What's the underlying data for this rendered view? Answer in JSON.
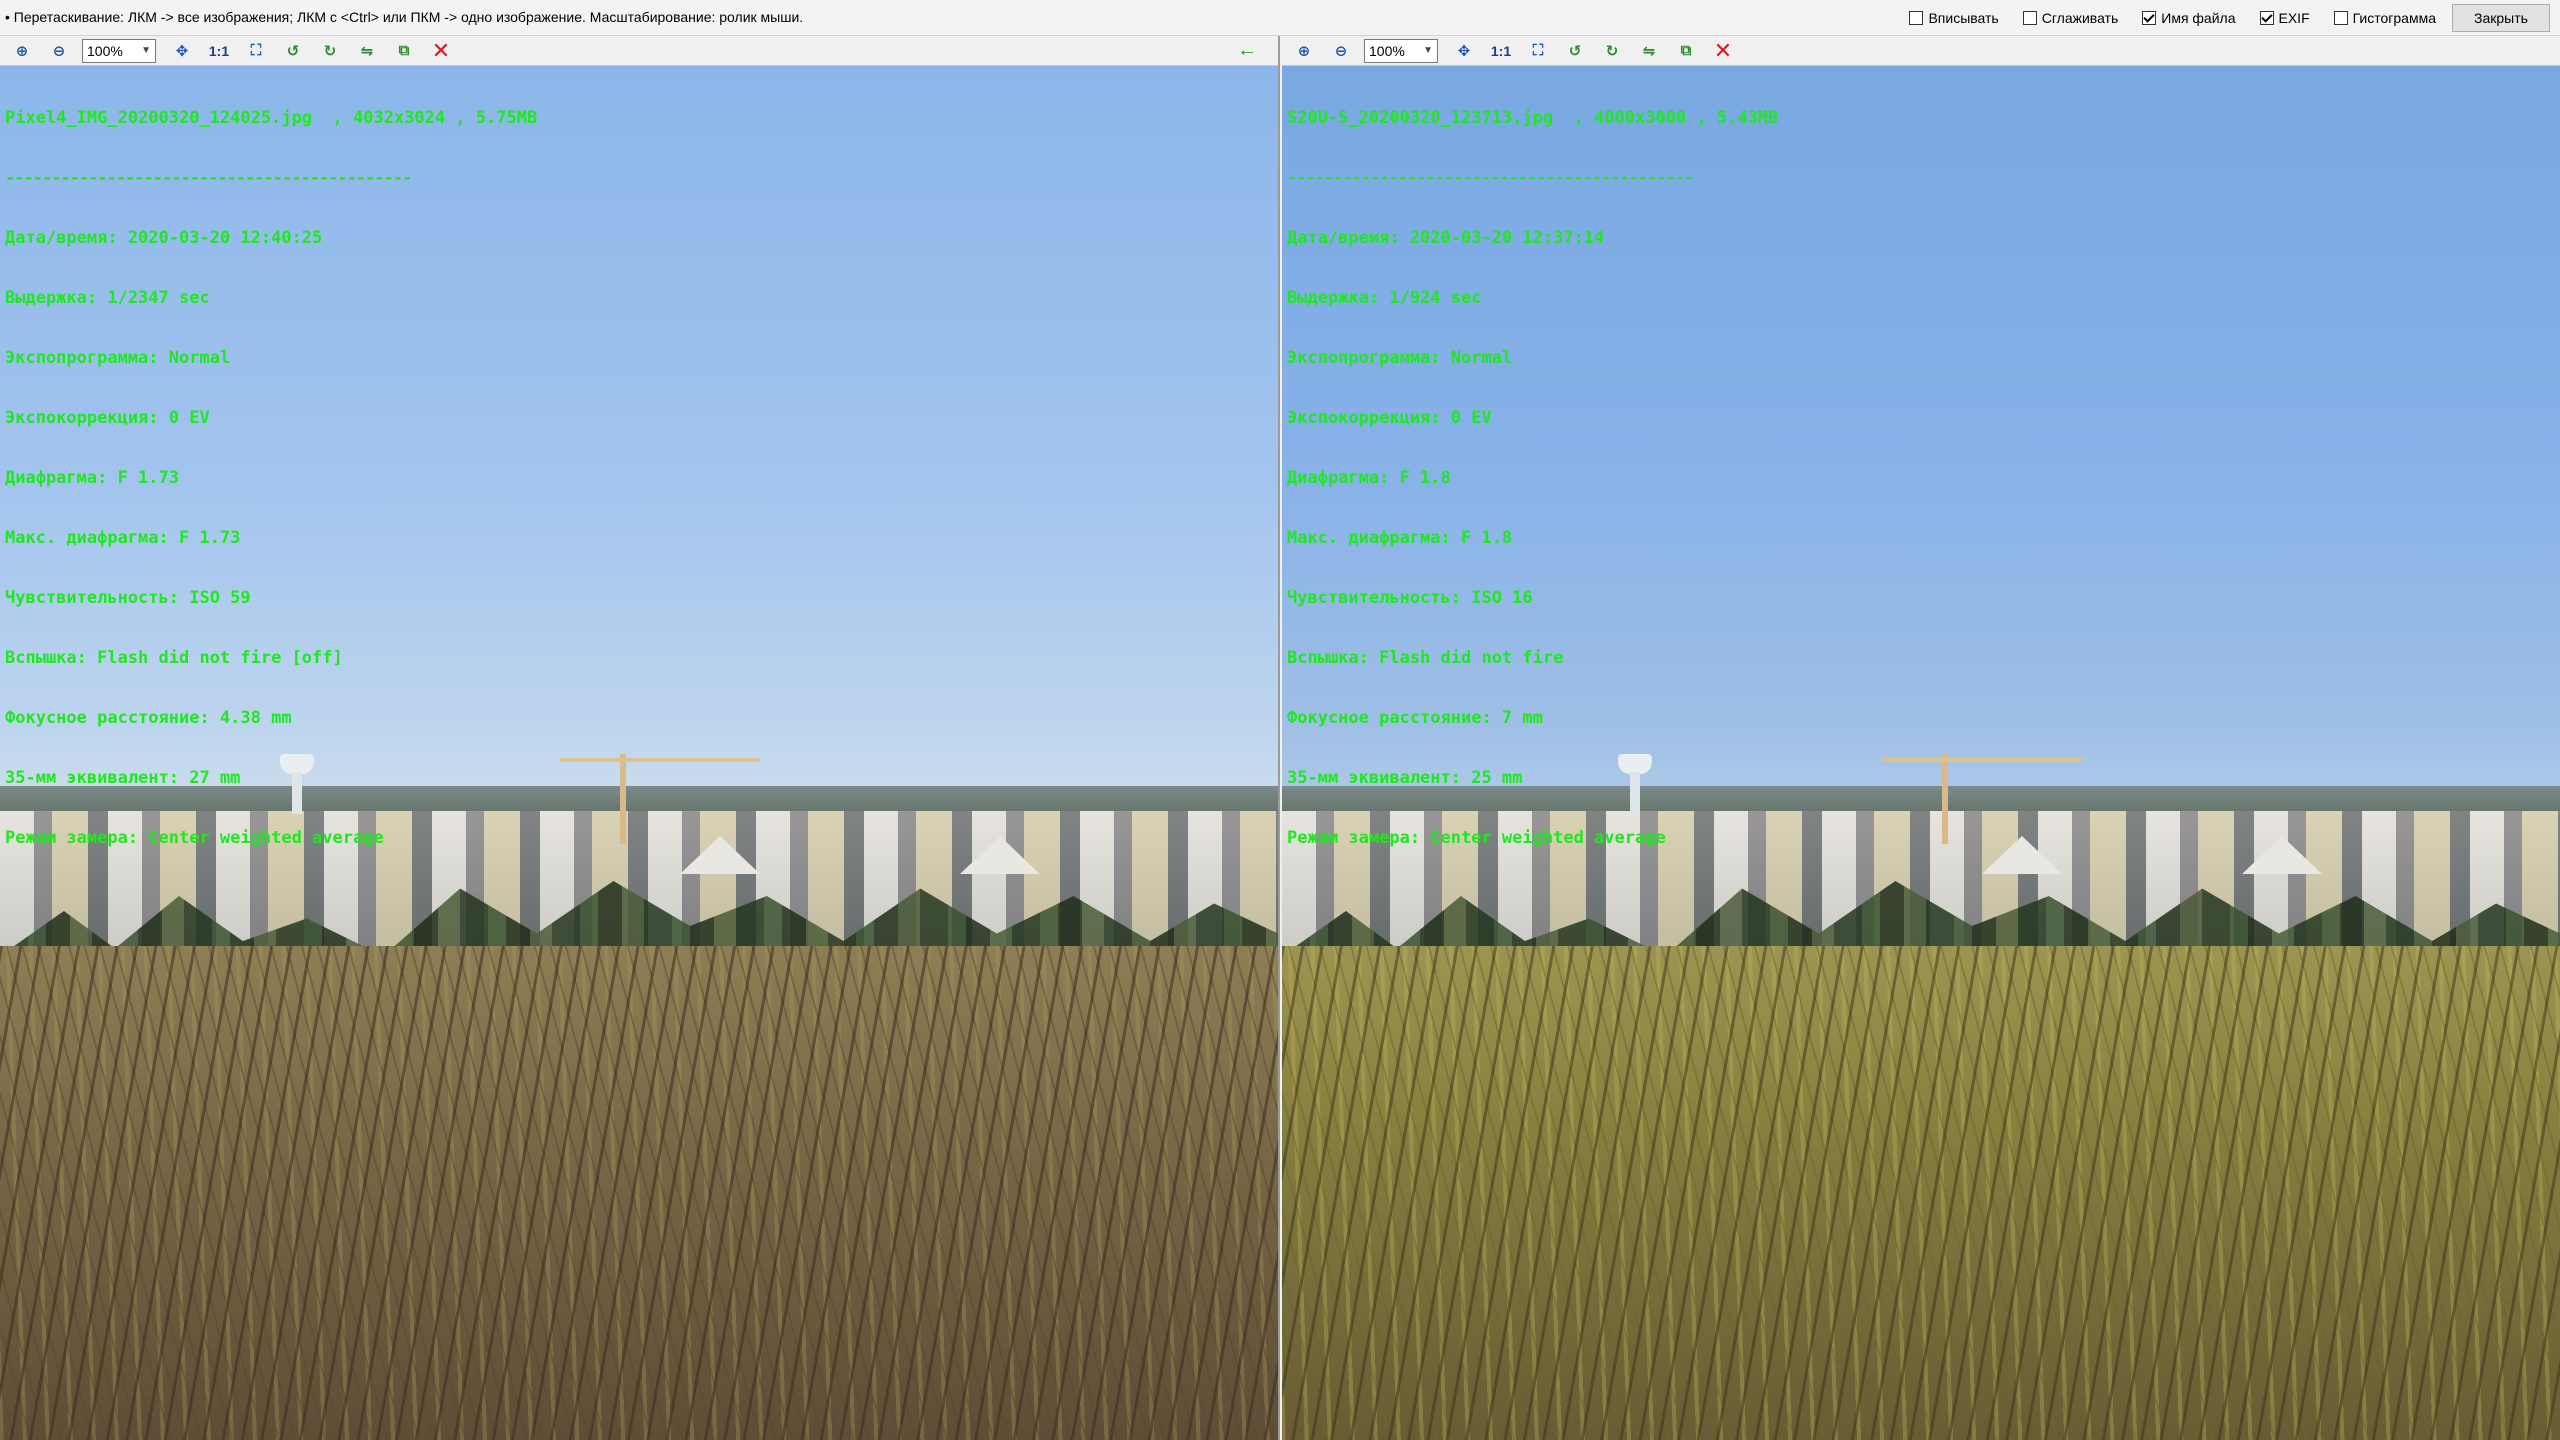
{
  "hint": "• Перетаскивание: ЛКМ -> все изображения; ЛКМ с <Ctrl> или ПКМ -> одно изображение. Масштабирование: ролик мыши.",
  "options": [
    {
      "label": "Вписывать",
      "checked": false
    },
    {
      "label": "Сглаживать",
      "checked": false
    },
    {
      "label": "Имя файла",
      "checked": true
    },
    {
      "label": "EXIF",
      "checked": true
    },
    {
      "label": "Гистограмма",
      "checked": false
    }
  ],
  "close_label": "Закрыть",
  "icons": {
    "zoom_in": "zoom-in-icon",
    "zoom_out": "zoom-out-icon",
    "one_to_one": "1:1",
    "fit": "fit-icon",
    "close": "close-icon",
    "sync": "arrow-left-icon"
  },
  "colors": {
    "exif_text": "#1ee81e",
    "close_icon": "#d81b1b"
  },
  "left": {
    "zoom": "100%",
    "header": "Pixel4_IMG_20200320_124025.jpg  , 4032x3024 , 5.75MB",
    "separator": "--------------------------------------------",
    "exif": [
      "Дата/время: 2020-03-20 12:40:25",
      "Выдержка: 1/2347 sec",
      "Экспопрограмма: Normal",
      "Экспокоррекция: 0 EV",
      "Диафрагма: F 1.73",
      "Макс. диафрагма: F 1.73",
      "Чувствительность: ISO 59",
      "Вспышка: Flash did not fire [off]",
      "Фокусное расстояние: 4.38 mm",
      "35-мм эквивалент: 27 mm",
      "Режим замера: Center weighted average"
    ]
  },
  "right": {
    "zoom": "100%",
    "header": "S20U-S_20200320_123713.jpg  , 4000x3000 , 5.43MB",
    "separator": "--------------------------------------------",
    "exif": [
      "Дата/время: 2020-03-20 12:37:14",
      "Выдержка: 1/924 sec",
      "Экспопрограмма: Normal",
      "Экспокоррекция: 0 EV",
      "Диафрагма: F 1.8",
      "Макс. диафрагма: F 1.8",
      "Чувствительность: ISO 16",
      "Вспышка: Flash did not fire",
      "Фокусное расстояние: 7 mm",
      "35-мм эквивалент: 25 mm",
      "Режим замера: Center weighted average"
    ]
  }
}
